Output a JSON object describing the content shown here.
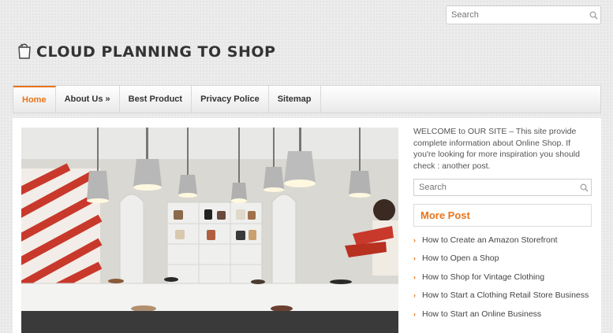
{
  "header": {
    "search_placeholder": "Search",
    "site_title": "CLOUD PLANNING TO SHOP",
    "logo_icon": "shopping-bag-icon"
  },
  "nav": {
    "items": [
      {
        "label": "Home",
        "active": true
      },
      {
        "label": "About Us »",
        "active": false
      },
      {
        "label": "Best Product",
        "active": false
      },
      {
        "label": "Privacy Police",
        "active": false
      },
      {
        "label": "Sitemap",
        "active": false
      }
    ]
  },
  "sidebar": {
    "welcome_text": "WELCOME to OUR SITE – This site provide complete information about Online Shop. If you're looking for more inspiration you should check : another post.",
    "search_placeholder": "Search",
    "widget_title": "More Post",
    "posts": [
      "How to Create an Amazon Storefront",
      "How to Open a Shop",
      "How to Shop for Vintage Clothing",
      "How to Start a Clothing Retail Store Business",
      "How to Start an Online Business"
    ]
  },
  "colors": {
    "accent": "#e8741a",
    "text": "#444444",
    "background": "#ececec"
  }
}
